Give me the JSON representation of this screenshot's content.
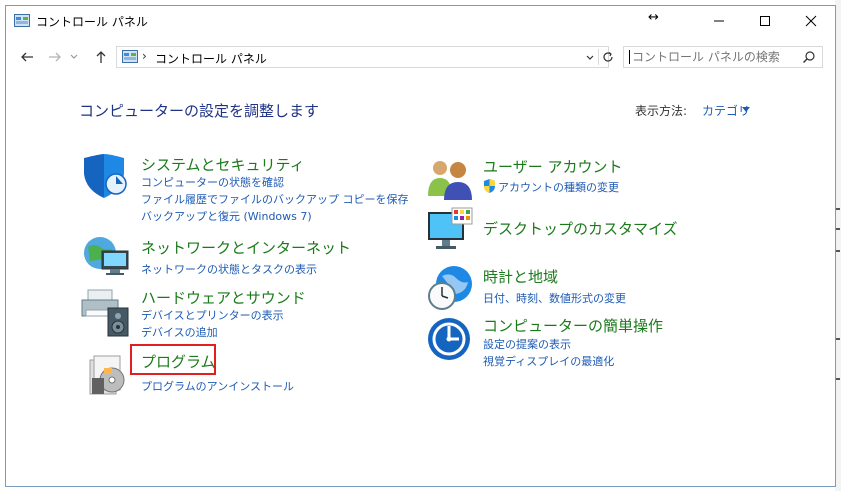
{
  "window": {
    "title": "コントロール パネル",
    "resize_glyph": "↔"
  },
  "address": {
    "path": "コントロール パネル",
    "separator": "›"
  },
  "search": {
    "placeholder": "コントロール パネルの検索"
  },
  "page": {
    "title": "コンピューターの設定を調整します",
    "view_label": "表示方法:",
    "view_value": "カテゴリ"
  },
  "categories": [
    {
      "title": "システムとセキュリティ",
      "links": [
        "コンピューターの状態を確認",
        "ファイル履歴でファイルのバックアップ コピーを保存",
        "バックアップと復元 (Windows 7)"
      ]
    },
    {
      "title": "ネットワークとインターネット",
      "links": [
        "ネットワークの状態とタスクの表示"
      ]
    },
    {
      "title": "ハードウェアとサウンド",
      "links": [
        "デバイスとプリンターの表示",
        "デバイスの追加"
      ]
    },
    {
      "title": "プログラム",
      "links": [
        "プログラムのアンインストール"
      ]
    },
    {
      "title": "ユーザー アカウント",
      "links": [
        "アカウントの種類の変更"
      ]
    },
    {
      "title": "デスクトップのカスタマイズ",
      "links": []
    },
    {
      "title": "時計と地域",
      "links": [
        "日付、時刻、数値形式の変更"
      ]
    },
    {
      "title": "コンピューターの簡単操作",
      "links": [
        "設定の提案の表示",
        "視覚ディスプレイの最適化"
      ]
    }
  ],
  "colors": {
    "category_title": "#1a7a1a",
    "link": "#1e5bb5",
    "page_title": "#1e3287",
    "highlight": "#e02020"
  }
}
